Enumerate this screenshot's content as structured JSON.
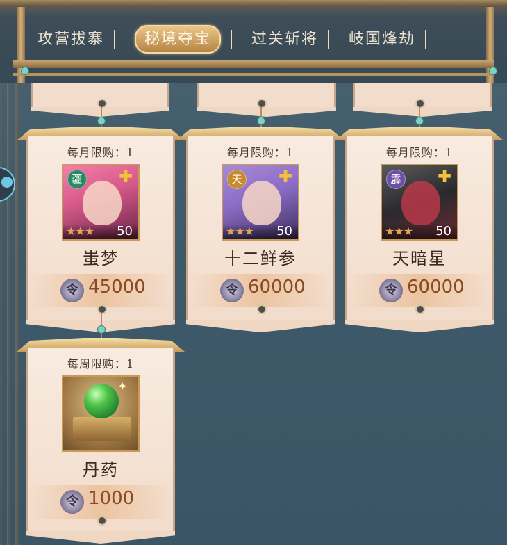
{
  "tabs": [
    {
      "label": "攻营拔寨",
      "active": false
    },
    {
      "label": "秘境夺宝",
      "active": true
    },
    {
      "label": "过关斩将",
      "active": false
    },
    {
      "label": "岐国烽劫",
      "active": false
    }
  ],
  "items": [
    {
      "limit": "每月限购：1",
      "name": "蚩梦",
      "price": "45000",
      "stars": 3,
      "level": "50",
      "badge": "疆",
      "badge_color": "#2c8a63",
      "icon": "hero-portrait-chimeng"
    },
    {
      "limit": "每月限购：1",
      "name": "十二鲜参",
      "price": "60000",
      "stars": 3,
      "level": "50",
      "badge": "天",
      "badge_color": "#c78a2e",
      "icon": "hero-portrait-shierxianshen"
    },
    {
      "limit": "每月限购：1",
      "name": "天暗星",
      "price": "60000",
      "stars": 3,
      "level": "50",
      "badge": "霹",
      "badge_color": "#6e4fa4",
      "icon": "hero-portrait-tiananxing"
    },
    {
      "limit": "每周限购：1",
      "name": "丹药",
      "price": "1000",
      "icon": "green-pill-on-book-icon"
    }
  ],
  "currency_icon": "silver-token-icon",
  "star_glyph": "★"
}
